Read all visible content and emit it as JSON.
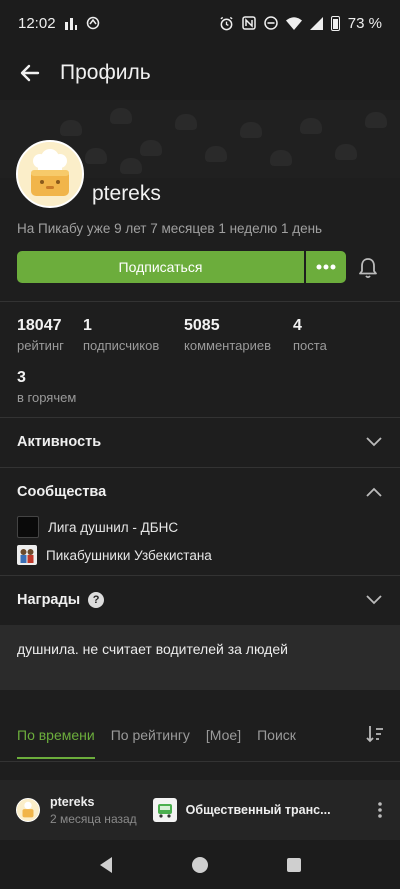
{
  "status": {
    "time": "12:02",
    "battery": "73 %"
  },
  "header": {
    "title": "Профиль"
  },
  "profile": {
    "username": "ptereks",
    "since": "На Пикабу уже 9 лет 7 месяцев 1 неделю 1 день",
    "subscribe_label": "Подписаться"
  },
  "stats": [
    {
      "value": "18047",
      "label": "рейтинг"
    },
    {
      "value": "1",
      "label": "подписчиков"
    },
    {
      "value": "5085",
      "label": "комментариев"
    },
    {
      "value": "4",
      "label": "поста"
    },
    {
      "value": "3",
      "label": "в горячем"
    }
  ],
  "sections": {
    "activity": "Активность",
    "communities": "Сообщества",
    "awards": "Награды"
  },
  "communities": [
    {
      "name": "Лига душнил - ДБНС"
    },
    {
      "name": "Пикабушники Узбекистана"
    }
  ],
  "bio": "душнила. не считает водителей за людей",
  "tabs": [
    {
      "label": "По времени"
    },
    {
      "label": "По рейтингу"
    },
    {
      "label": "[Мое]"
    },
    {
      "label": "Поиск"
    }
  ],
  "post": {
    "author": "ptereks",
    "time": "2 месяца назад",
    "community": "Общественный транс..."
  },
  "colors": {
    "accent": "#6cad3c",
    "background": "#1e1e1e"
  }
}
